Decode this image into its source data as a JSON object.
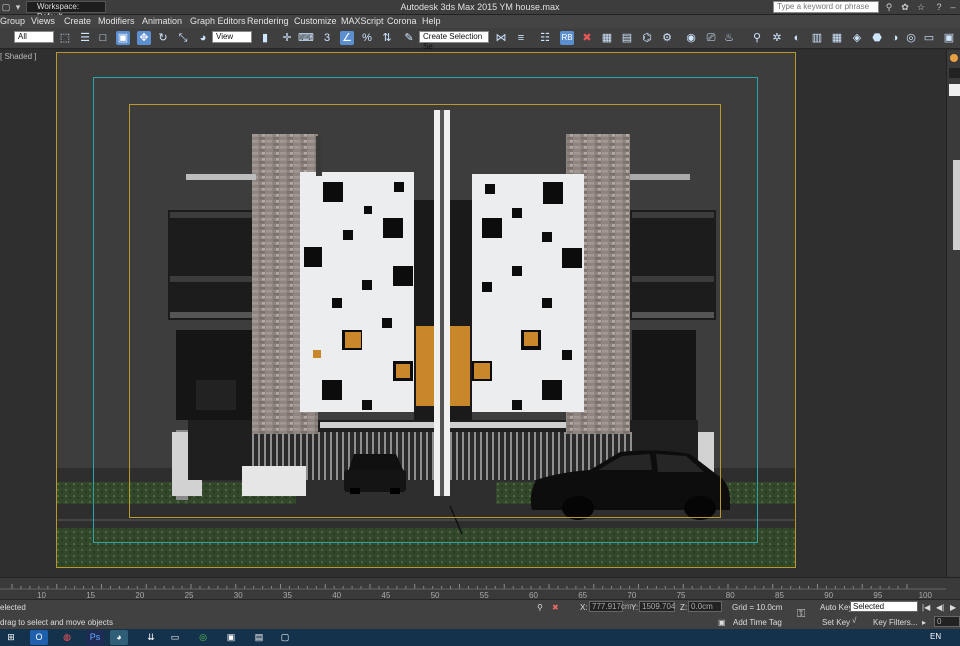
{
  "titlebar": {
    "workspace": "Workspace: Default",
    "title": "Autodesk 3ds Max  2015    YM house.max",
    "search_placeholder": "Type a keyword or phrase"
  },
  "menu": [
    "Group",
    "Views",
    "Create",
    "Modifiers",
    "Animation",
    "Graph Editors",
    "Rendering",
    "Customize",
    "MAXScript",
    "Corona",
    "Help"
  ],
  "toolbar": {
    "filter": "All",
    "refcoord": "View",
    "selection_set": "Create Selection Se",
    "rb_label": "RB"
  },
  "viewport": {
    "label": "[ Shaded ]"
  },
  "timeline": {
    "ticks": [
      "10",
      "15",
      "20",
      "25",
      "30",
      "35",
      "40",
      "45",
      "50",
      "55",
      "60",
      "65",
      "70",
      "75",
      "80",
      "85",
      "90",
      "95",
      "100"
    ]
  },
  "status": {
    "selected": "elected",
    "prompt": "drag to select and move objects",
    "x_label": "X:",
    "x": "777.917cm",
    "y_label": "Y:",
    "y": "1509.704",
    "z_label": "Z:",
    "z": "0.0cm",
    "grid": "Grid = 10.0cm",
    "add_time_tag": "Add Time Tag",
    "auto_key": "Auto Key",
    "auto_key_value": "Selected",
    "set_key": "Set Key",
    "key_filters": "Key Filters...",
    "frame": "0"
  },
  "taskbar": {
    "lang": "EN"
  },
  "colors": {
    "safe_frame_outer": "#b89a2a",
    "safe_frame_action": "#2aa6a6",
    "wall_white": "#ecedee",
    "brick": "#8e8580"
  }
}
